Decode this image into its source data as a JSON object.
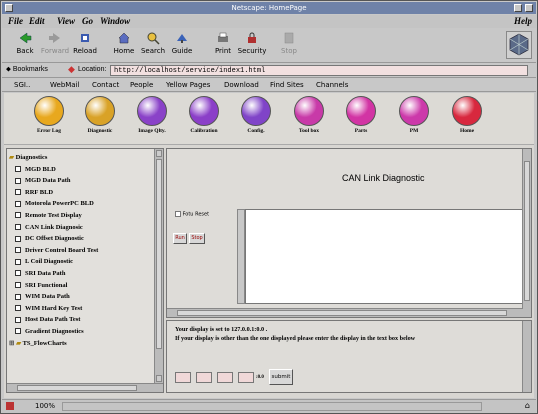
{
  "window": {
    "title": "Netscape: HomePage"
  },
  "menu": {
    "file": "File",
    "edit": "Edit",
    "view": "View",
    "go": "Go",
    "window": "Window",
    "help": "Help"
  },
  "toolbar": {
    "back": "Back",
    "forward": "Forward",
    "reload": "Reload",
    "home": "Home",
    "search": "Search",
    "guide": "Guide",
    "print": "Print",
    "security": "Security",
    "stop": "Stop"
  },
  "location": {
    "bookmarks": "Bookmarks",
    "label": "Location:",
    "url": "http://localhost/service/index1.html"
  },
  "personal": {
    "items": [
      "SGI..",
      "WebMail",
      "Contact",
      "People",
      "Yellow Pages",
      "Download",
      "Find Sites",
      "Channels"
    ]
  },
  "nav": {
    "items": [
      {
        "label": "Error Log",
        "color": "#e8a81e"
      },
      {
        "label": "Diagnostic",
        "color": "#d9a227"
      },
      {
        "label": "Image Qlty.",
        "color": "#8a42c8"
      },
      {
        "label": "Calibration",
        "color": "#8b3fc8"
      },
      {
        "label": "Config.",
        "color": "#8044c8"
      },
      {
        "label": "Tool box",
        "color": "#c83aa8"
      },
      {
        "label": "Parts",
        "color": "#d234a4"
      },
      {
        "label": "PM",
        "color": "#cc39aa"
      },
      {
        "label": "Home",
        "color": "#d8283e"
      }
    ]
  },
  "tree": {
    "root": "Diagnostics",
    "items": [
      "MGD BLD",
      "MGD Data Path",
      "RRF BLD",
      "Motorola PowerPC BLD",
      "Remote Test Display",
      "CAN Link Diagnosic",
      "DC Offset Diagnostic",
      "Driver Control Board Test",
      "L Coil Diagnostic",
      "SRI Data Path",
      "SRI Functional",
      "WIM Data Path",
      "WIM Hard Key Test",
      "Host Data Path Test",
      "Gradient Diagnostics"
    ],
    "folder": "TS_FlowCharts"
  },
  "diag": {
    "title": "CAN Link Diagnostic",
    "checkbox_label": "Fotu Reset",
    "run": "Run",
    "stop": "Stop"
  },
  "display": {
    "line1": "Your display is set to 127.0.0.1:0.0 .",
    "line2": "If your display is other than the one displayed please enter the display in the text box below",
    "suffix": ":0.0",
    "submit": "submit"
  },
  "status": {
    "zoom": "100%"
  }
}
